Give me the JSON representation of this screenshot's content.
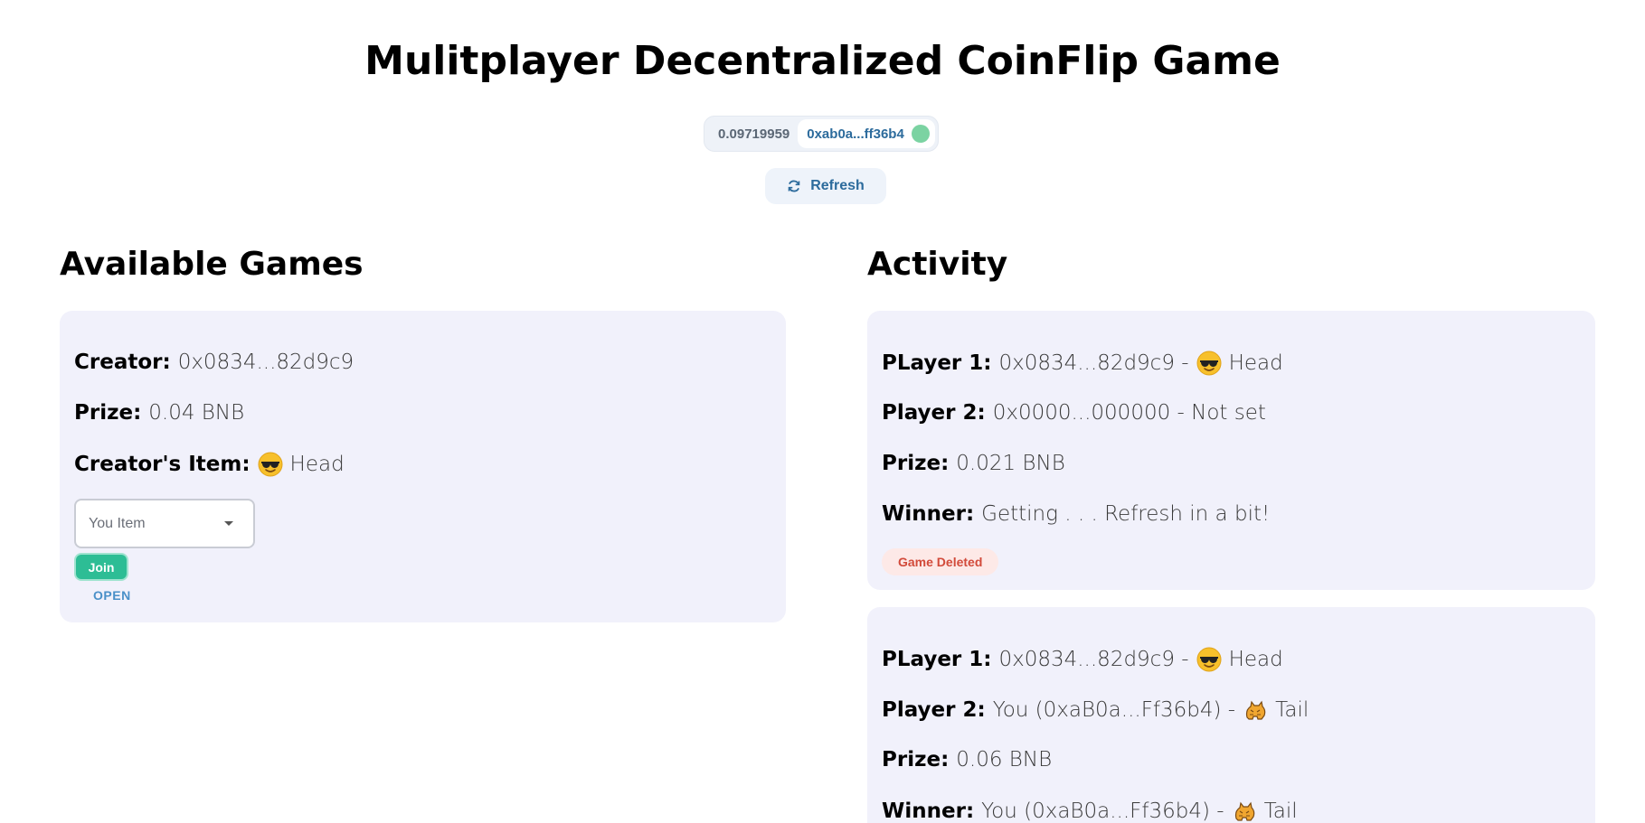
{
  "header": {
    "title": "Mulitplayer Decentralized CoinFlip Game"
  },
  "wallet": {
    "balance": "0.09719959",
    "address": "0xab0a...ff36b4",
    "status_color": "#7bd3a2"
  },
  "refresh": {
    "label": "Refresh",
    "icon": "refresh-icon"
  },
  "available_games": {
    "heading": "Available Games",
    "games": [
      {
        "creator_label": "Creator:",
        "creator_value": "0x0834...82d9c9",
        "prize_label": "Prize:",
        "prize_value": "0.04 BNB",
        "item_label": "Creator's Item:",
        "item_icon": "sunglasses-emoji",
        "item_value": "Head",
        "select_placeholder": "You Item",
        "join_label": "Join",
        "status": "OPEN"
      }
    ]
  },
  "activity": {
    "heading": "Activity",
    "items": [
      {
        "p1_label": "PLayer 1:",
        "p1_value": "0x0834...82d9c9 -",
        "p1_icon": "sunglasses-emoji",
        "p1_item": "Head",
        "p2_label": "Player 2:",
        "p2_value": "0x0000...000000 - Not set",
        "prize_label": "Prize:",
        "prize_value": "0.021 BNB",
        "winner_label": "Winner:",
        "winner_value": "Getting . . . Refresh in a bit!",
        "badge": "Game Deleted"
      },
      {
        "p1_label": "PLayer 1:",
        "p1_value": "0x0834...82d9c9 -",
        "p1_icon": "sunglasses-emoji",
        "p1_item": "Head",
        "p2_label": "Player 2:",
        "p2_value": "You (0xaB0a...Ff36b4) -",
        "p2_icon": "cat-emoji",
        "p2_item": "Tail",
        "prize_label": "Prize:",
        "prize_value": "0.06 BNB",
        "winner_label": "Winner:",
        "winner_value": "You (0xaB0a...Ff36b4) -",
        "winner_icon": "cat-emoji",
        "winner_item": "Tail"
      }
    ]
  },
  "colors": {
    "card_bg": "#f1f1fb",
    "accent_blue": "#2c6b9c",
    "join_green": "#2dbd95",
    "badge_red": "#d24a3a"
  }
}
